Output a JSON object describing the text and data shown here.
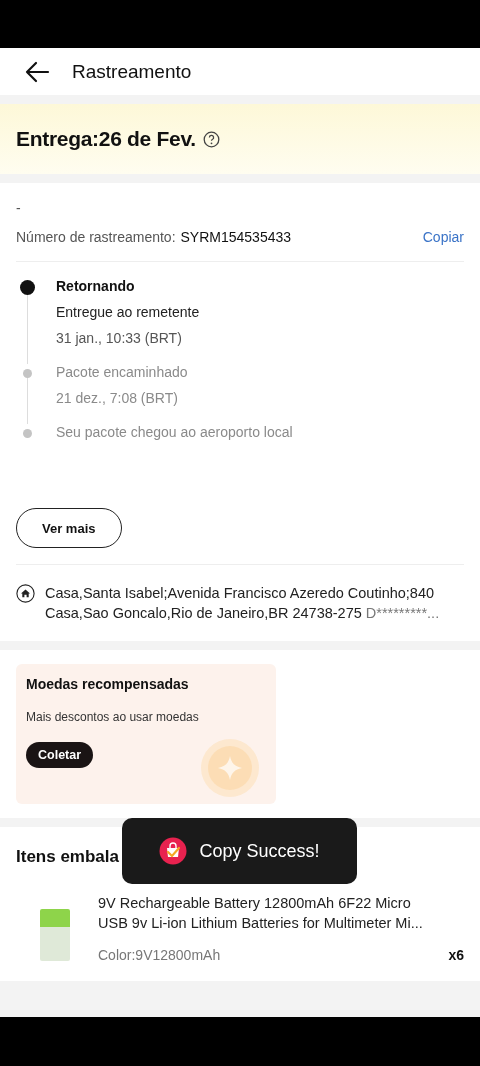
{
  "header": {
    "title": "Rastreamento"
  },
  "delivery": {
    "label": "Entrega:26 de Fev."
  },
  "tracking": {
    "dash": "-",
    "number_label": "Número de rastreamento:",
    "number": "SYRM154535433",
    "copy_link": "Copiar",
    "events": [
      {
        "status": "Retornando",
        "detail": "Entregue ao remetente",
        "time": "31 jan., 10:33 (BRT)",
        "active": true
      },
      {
        "detail": "Pacote encaminhado",
        "time": "21 dez., 7:08 (BRT)",
        "active": false
      },
      {
        "detail": "Seu pacote chegou ao aeroporto local",
        "active": false
      }
    ],
    "more_button": "Ver mais",
    "address": "Casa,Santa Isabel;Avenida Francisco Azeredo Coutinho;840 Casa,Sao Goncalo,Rio de Janeiro,BR 24738-275",
    "recipient": "D*********..."
  },
  "coins": {
    "title": "Moedas recompensadas",
    "subtitle": "Mais descontos ao usar moedas",
    "button": "Coletar"
  },
  "items": {
    "title": "Itens embala",
    "products": [
      {
        "name": "9V Rechargeable Battery 12800mAh 6F22 Micro USB 9v Li-ion Lithium Batteries for Multimeter Mi...",
        "variant": "Color:9V12800mAh",
        "quantity": "x6"
      }
    ]
  },
  "toast": {
    "message": "Copy Success!"
  }
}
